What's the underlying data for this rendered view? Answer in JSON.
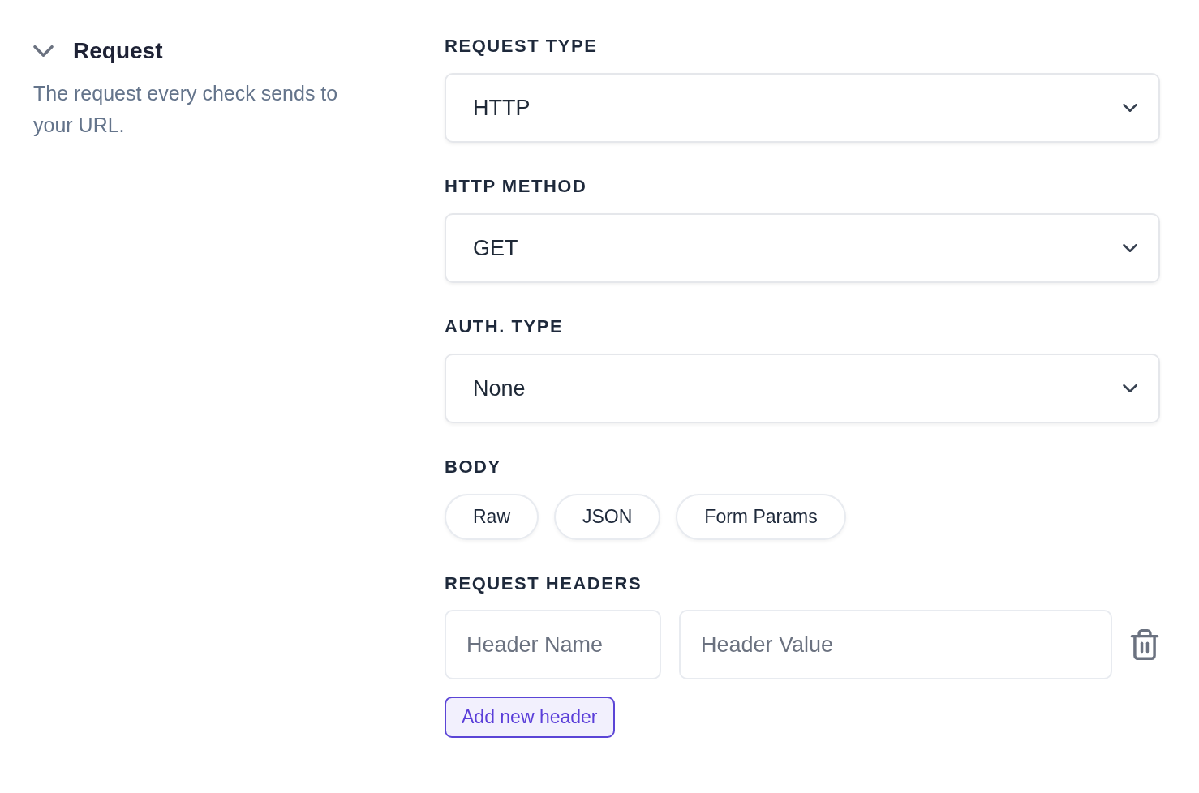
{
  "section": {
    "title": "Request",
    "expanded": true,
    "description": "The request every check sends to your URL."
  },
  "fields": [
    {
      "kind": "select",
      "label": "REQUEST TYPE",
      "value": "HTTP"
    },
    {
      "kind": "select",
      "label": "HTTP METHOD",
      "value": "GET"
    },
    {
      "kind": "select",
      "label": "AUTH. TYPE",
      "value": "None"
    },
    {
      "kind": "choices",
      "label": "BODY",
      "options": [
        {
          "label": "Raw",
          "selected": false
        },
        {
          "label": "JSON",
          "selected": false
        },
        {
          "label": "Form Params",
          "selected": false
        }
      ]
    },
    {
      "kind": "headers",
      "label": "REQUEST HEADERS",
      "rows": [
        {
          "name_placeholder": "Header Name",
          "value_placeholder": "Header Value"
        }
      ],
      "add_button": "Add new header"
    }
  ]
}
